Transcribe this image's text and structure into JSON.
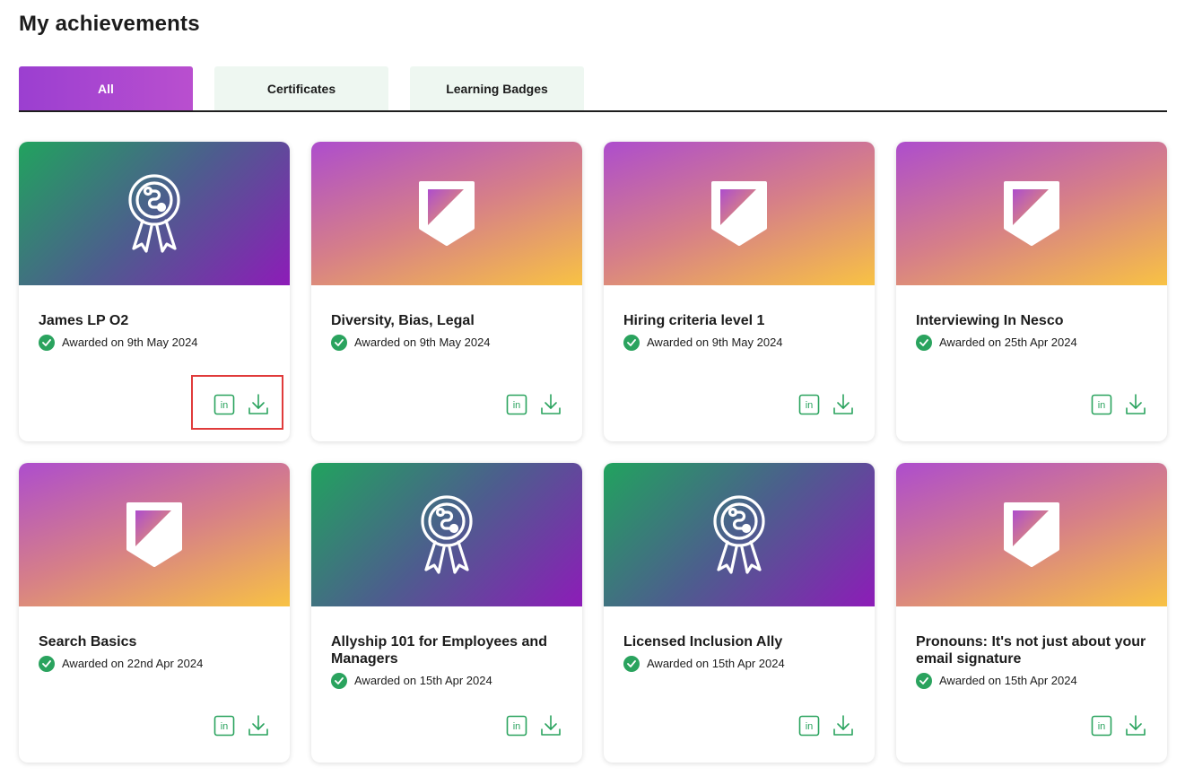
{
  "page": {
    "title": "My achievements"
  },
  "tabs": [
    {
      "label": "All",
      "active": true
    },
    {
      "label": "Certificates",
      "active": false
    },
    {
      "label": "Learning Badges",
      "active": false
    }
  ],
  "colors": {
    "accent_green": "#2aa35e",
    "tab_active_from": "#9b3fd0",
    "tab_active_to": "#b94fcf",
    "tab_inactive_bg": "#eef7f1",
    "highlight_border": "#e03b3b"
  },
  "cards": [
    {
      "title": "James LP O2",
      "awarded": "Awarded on 9th May 2024",
      "icon": "ribbon-award-icon"
    },
    {
      "title": "Diversity, Bias, Legal",
      "awarded": "Awarded on 9th May 2024",
      "icon": "shield-badge-icon"
    },
    {
      "title": "Hiring criteria level 1",
      "awarded": "Awarded on 9th May 2024",
      "icon": "shield-badge-icon"
    },
    {
      "title": "Interviewing In Nesco",
      "awarded": "Awarded on 25th Apr 2024",
      "icon": "shield-badge-icon"
    },
    {
      "title": "Search Basics",
      "awarded": "Awarded on 22nd Apr 2024",
      "icon": "shield-badge-icon"
    },
    {
      "title": "Allyship 101 for Employees and Managers",
      "awarded": "Awarded on 15th Apr 2024",
      "icon": "ribbon-award-icon"
    },
    {
      "title": "Licensed Inclusion Ally",
      "awarded": "Awarded on 15th Apr 2024",
      "icon": "ribbon-award-icon"
    },
    {
      "title": "Pronouns: It's not just about your email signature",
      "awarded": "Awarded on 15th Apr 2024",
      "icon": "shield-badge-icon"
    }
  ],
  "card_actions": [
    {
      "icon": "linkedin-icon"
    },
    {
      "icon": "download-icon"
    }
  ]
}
